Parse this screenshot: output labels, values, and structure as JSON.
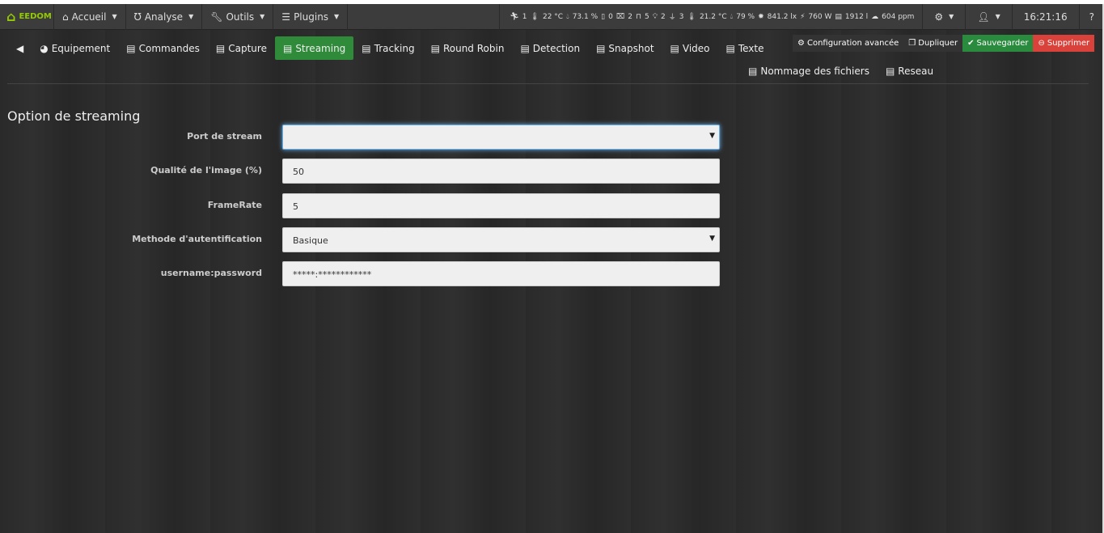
{
  "navbar": {
    "logo": "EEDOM",
    "menus": [
      {
        "label": "Accueil",
        "icon": "home-icon"
      },
      {
        "label": "Analyse",
        "icon": "stethoscope-icon"
      },
      {
        "label": "Outils",
        "icon": "wrench-icon"
      },
      {
        "label": "Plugins",
        "icon": "tasks-icon"
      }
    ],
    "status": [
      "1",
      "22 °C",
      "73.1 %",
      "0",
      "2",
      "5",
      "2",
      "3",
      "21.2 °C",
      "79 %",
      "841.2 lx",
      "760 W",
      "1912 l",
      "604 ppm"
    ],
    "time": "16:21:16"
  },
  "tabs": [
    {
      "label": "Equipement"
    },
    {
      "label": "Commandes"
    },
    {
      "label": "Capture"
    },
    {
      "label": "Streaming",
      "active": true
    },
    {
      "label": "Tracking"
    },
    {
      "label": "Round Robin"
    },
    {
      "label": "Detection"
    },
    {
      "label": "Snapshot"
    },
    {
      "label": "Video"
    },
    {
      "label": "Texte"
    }
  ],
  "tabs2": [
    {
      "label": "Nommage des fichiers"
    },
    {
      "label": "Reseau"
    }
  ],
  "actions": {
    "config": "Configuration avancée",
    "duplicate": "Dupliquer",
    "save": "Sauvegarder",
    "delete": "Supprimer"
  },
  "colors": {
    "save": "#2a8a3e",
    "delete": "#d9423b",
    "active_tab": "#2f8a3a",
    "logo": "#94ca02"
  },
  "form": {
    "title": "Option de streaming",
    "fields": [
      {
        "label": "Port de stream",
        "value": "",
        "type": "select"
      },
      {
        "label": "Qualité de l'image (%)",
        "value": "50",
        "type": "input"
      },
      {
        "label": "FrameRate",
        "value": "5",
        "type": "input"
      },
      {
        "label": "Methode d'autentification",
        "value": "Basique",
        "type": "select"
      },
      {
        "label": "username:password",
        "value": "*****:************",
        "type": "input"
      }
    ]
  }
}
